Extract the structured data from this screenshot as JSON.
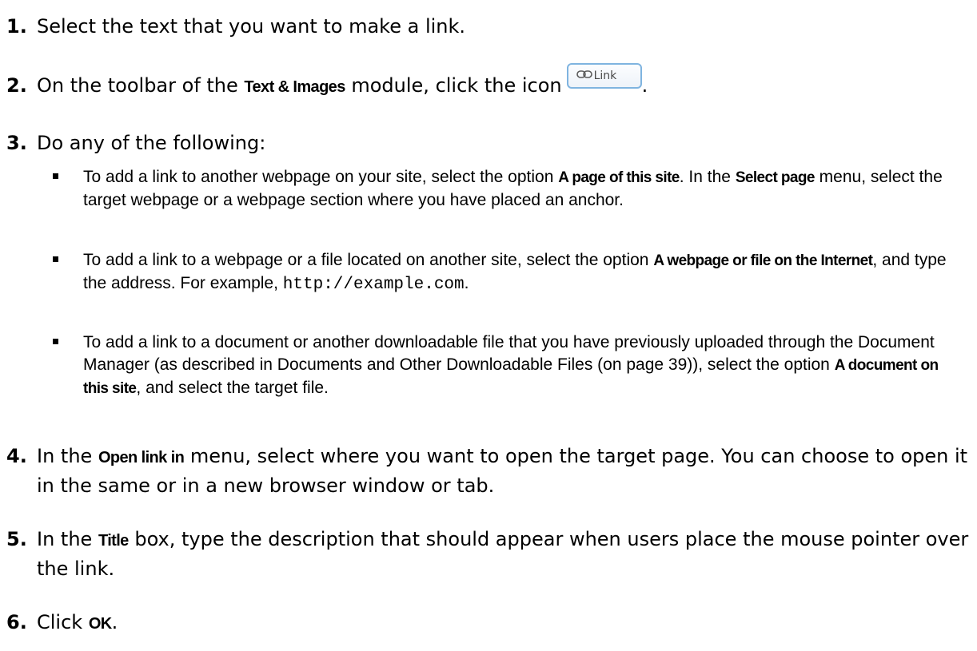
{
  "steps": [
    {
      "num": "1.",
      "text": "Select the text that you want to make a link."
    },
    {
      "num": "2.",
      "pre": "On the toolbar of the ",
      "bold": "Text & Images",
      "mid": " module, click the icon",
      "post": ".",
      "button_label": "Link",
      "button_icon": "link-chain-icon"
    },
    {
      "num": "3.",
      "text": "Do any of the following:"
    },
    {
      "num": "4.",
      "pre": "In the ",
      "bold": "Open link in",
      "post": " menu, select where you want to open the target page. You can choose to open it in the same or in a new browser window or tab."
    },
    {
      "num": "5.",
      "pre": "In the ",
      "bold": "Title",
      "post": " box, type the description that should appear when users place the mouse pointer over the link."
    },
    {
      "num": "6.",
      "pre": "Click ",
      "bold": "OK",
      "post": "."
    }
  ],
  "substeps": [
    {
      "pre": "To add a link to another webpage on your site, select the option ",
      "bold1": "A page of this site",
      "mid": ". In the ",
      "bold2": "Select page",
      "post": " menu, select the target webpage or a webpage section where you have placed an anchor."
    },
    {
      "pre": "To add a link to a webpage or a file located on another site, select the option ",
      "bold1": "A webpage or file on the Internet",
      "mid": ", and type the address. For example, ",
      "code": "http://example.com",
      "post": "."
    },
    {
      "pre": "To add a link to a document or another downloadable file that you have previously uploaded through the Document Manager (as described in Documents and Other Downloadable Files (on page 39)), select the option ",
      "bold1": "A document on this site",
      "post": ", and select the target file."
    }
  ]
}
